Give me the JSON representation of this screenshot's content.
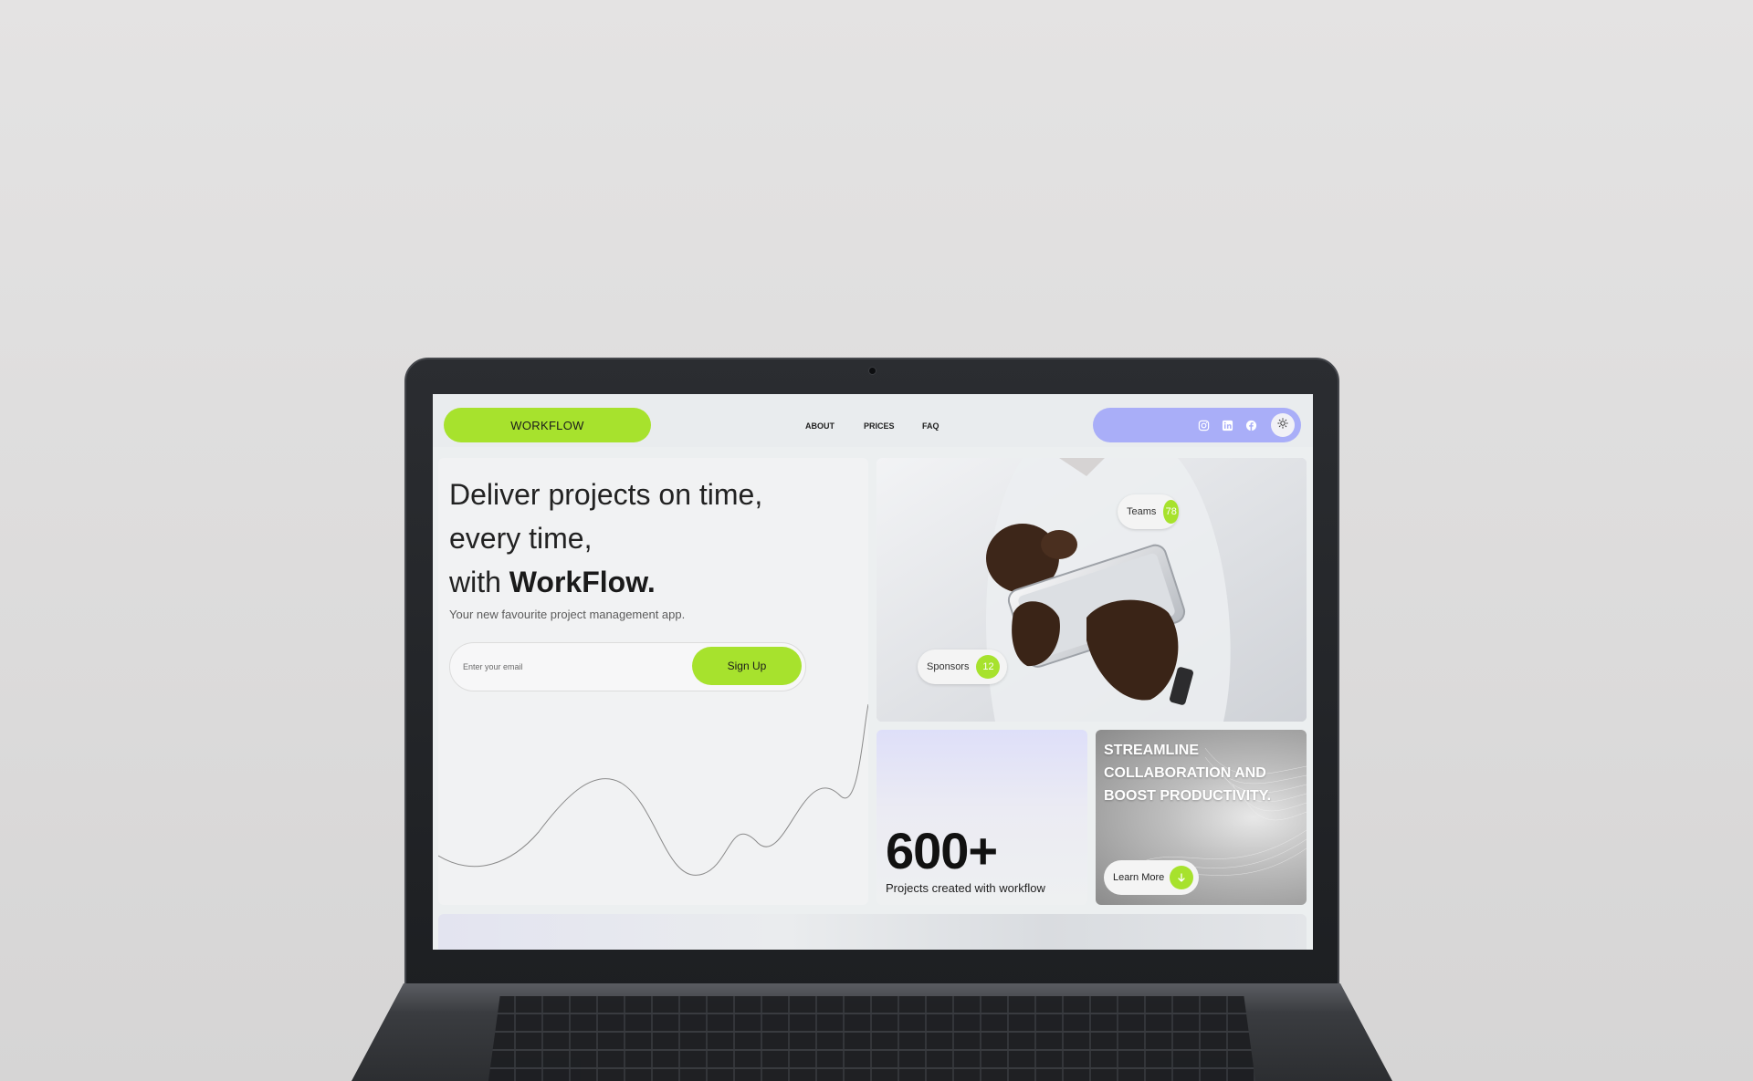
{
  "nav": {
    "logo": "WORKFLOW",
    "links": [
      "ABOUT",
      "PRICES",
      "FAQ"
    ],
    "social_icons": [
      "instagram-icon",
      "linkedin-icon",
      "facebook-icon"
    ],
    "theme_icon": "sun-icon",
    "colors": {
      "logo_bg": "#a7e22d",
      "social_bg": "#a9aef8"
    }
  },
  "hero": {
    "title_line1": "Deliver projects on time,",
    "title_line2": "every time,",
    "title_with": "with",
    "title_brand": "WorkFlow.",
    "subtitle": "Your new favourite project management app.",
    "email_placeholder": "Enter your email",
    "signup_label": "Sign Up"
  },
  "photo": {
    "teams_label": "Teams",
    "teams_count": "78",
    "sponsors_label": "Sponsors",
    "sponsors_count": "12"
  },
  "stats": {
    "number": "600+",
    "label": "Projects created with workflow"
  },
  "promo": {
    "text": "STREAMLINE COLLABORATION AND BOOST PRODUCTIVITY.",
    "button_label": "Learn More",
    "button_icon": "arrow-down-icon"
  }
}
